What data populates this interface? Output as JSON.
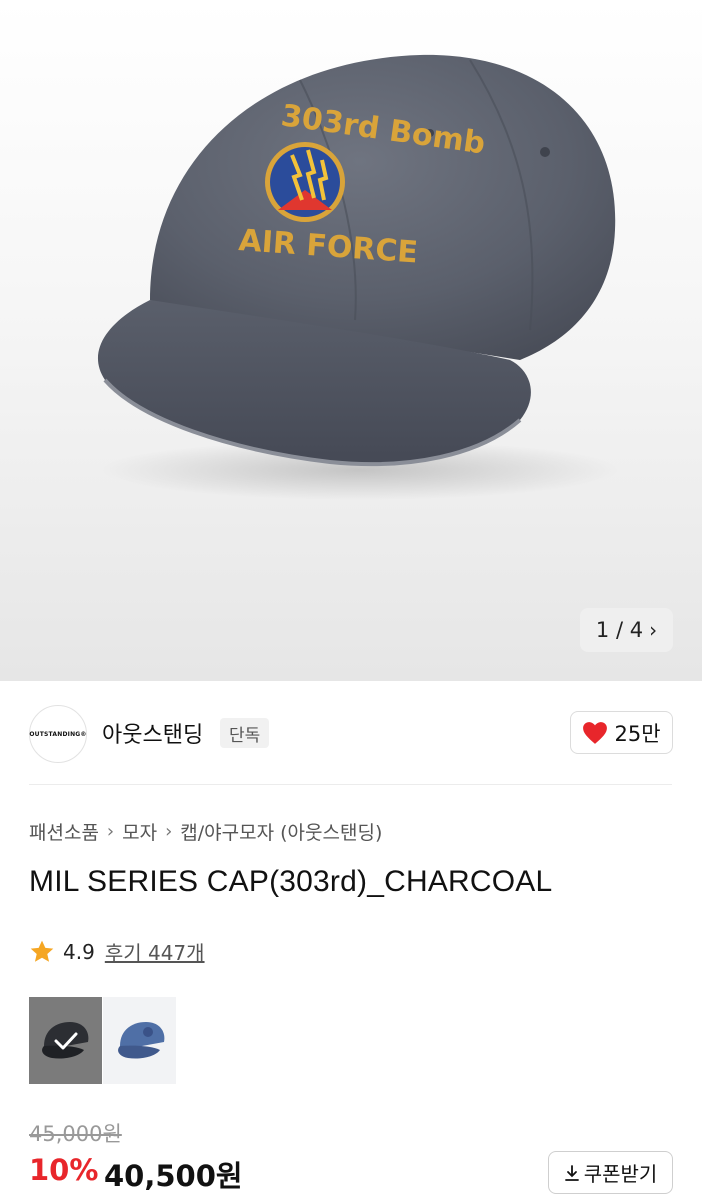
{
  "gallery": {
    "counter": "1 / 4",
    "patch_text_top": "303rd Bomb",
    "patch_text_bottom": "AIR FORCE"
  },
  "brand": {
    "logo_text": "OUTSTANDING®",
    "name": "아웃스탠딩",
    "badge": "단독",
    "likes": "25만"
  },
  "breadcrumb": [
    "패션소품",
    "모자",
    "캡/야구모자 (아웃스탠딩)"
  ],
  "product": {
    "title": "MIL SERIES CAP(303rd)_CHARCOAL",
    "rating": "4.9",
    "reviews": "후기 447개"
  },
  "options": [
    {
      "name": "charcoal",
      "selected": true
    },
    {
      "name": "blue",
      "selected": false
    }
  ],
  "price": {
    "original": "45,000원",
    "discount": "10%",
    "sale": "40,500원"
  },
  "coupon": {
    "label": "쿠폰받기"
  },
  "colors": {
    "accent_red": "#e8262b",
    "cap_charcoal": "#5e6370",
    "star": "#f5a623"
  }
}
